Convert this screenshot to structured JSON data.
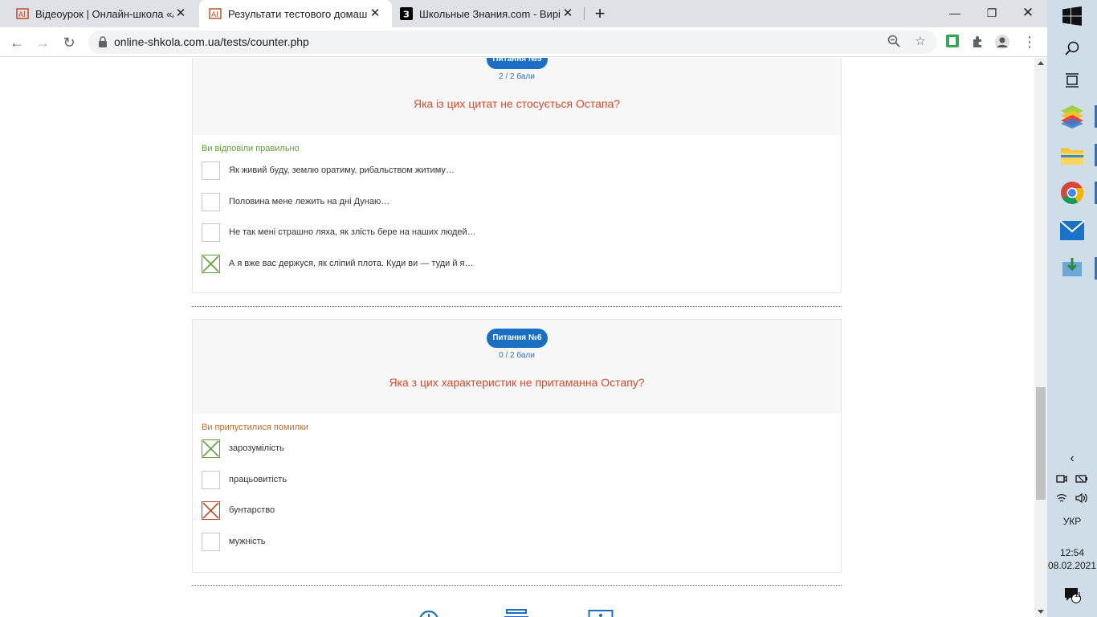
{
  "browser": {
    "tabs": [
      {
        "title": "Відеоурок | Онлайн-школа «Альтернатива»"
      },
      {
        "title": "Результати тестового домашнього завдання"
      },
      {
        "title": "Школьные Знания.com - Вирішуй"
      }
    ],
    "url": "online-shkola.com.ua/tests/counter.php"
  },
  "questions": [
    {
      "badge": "Питання №5",
      "score": "2 / 2 бали",
      "text": "Яка із цих цитат не стосується Остапа?",
      "status": "Ви відповіли правильно",
      "options": [
        {
          "label": "Як живий буду, землю оратиму, рибальством житиму…",
          "mark": "none"
        },
        {
          "label": "Половина мене лежить на дні Дунаю…",
          "mark": "none"
        },
        {
          "label": "Не так мені страшно ляха, як злість бере на наших людей…",
          "mark": "none"
        },
        {
          "label": "А я вже вас держуся, як сліпий плота. Куди ви — туди й я…",
          "mark": "green"
        }
      ]
    },
    {
      "badge": "Питання №6",
      "score": "0 / 2 бали",
      "text": "Яка з цих характеристик не притаманна Остапу?",
      "status": "Ви припустилися помилки",
      "options": [
        {
          "label": "зарозумілість",
          "mark": "green"
        },
        {
          "label": "працьовитість",
          "mark": "none"
        },
        {
          "label": "бунтарство",
          "mark": "red"
        },
        {
          "label": "мужність",
          "mark": "none"
        }
      ]
    }
  ],
  "tray": {
    "language": "УКР",
    "time": "12:54",
    "date": "08.02.2021",
    "notifications": "11"
  },
  "colors": {
    "accent": "#1a6fc4",
    "question": "#d94a2b",
    "correct": "#5aa12d",
    "wrong": "#c0461f"
  }
}
